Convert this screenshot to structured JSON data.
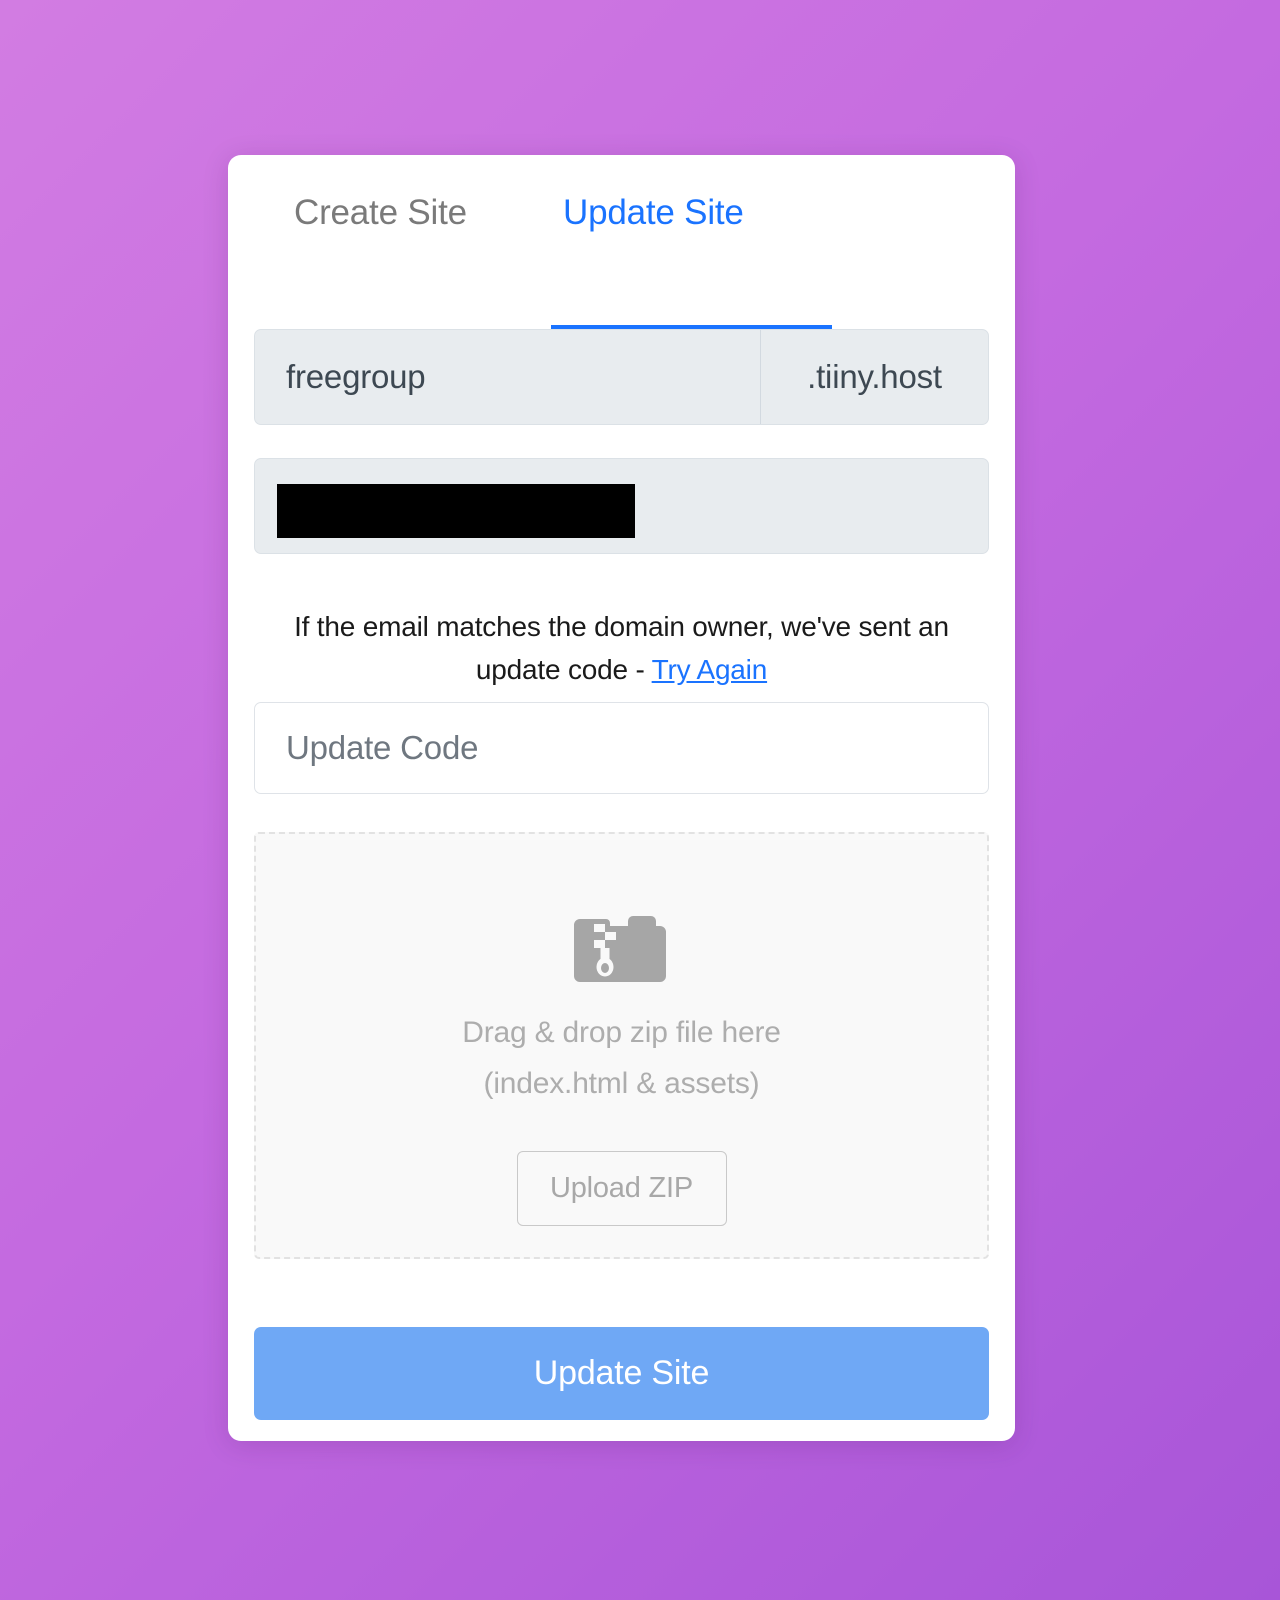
{
  "background": {
    "gradient_from": "#d27ce2",
    "gradient_to": "#a855d8"
  },
  "theme": {
    "accent_blue": "#1a73ff",
    "button_blue": "#6fa8f5",
    "field_grey": "#e8ecef",
    "muted_text": "#adadad"
  },
  "tabs": [
    {
      "label": "Create Site",
      "active": false
    },
    {
      "label": "Update Site",
      "active": true
    }
  ],
  "domain": {
    "name_value": "freegroup",
    "suffix": ".tiiny.host"
  },
  "email": {
    "value": "",
    "redacted": true
  },
  "notice": {
    "text_before": "If the email matches the domain owner, we've sent an update code - ",
    "link_label": "Try Again"
  },
  "update_code": {
    "placeholder": "Update Code",
    "value": ""
  },
  "dropzone": {
    "icon": "file-archive-icon",
    "line1": "Drag & drop zip file here",
    "line2": "(index.html & assets)",
    "upload_button_label": "Upload ZIP"
  },
  "submit": {
    "label": "Update Site"
  }
}
